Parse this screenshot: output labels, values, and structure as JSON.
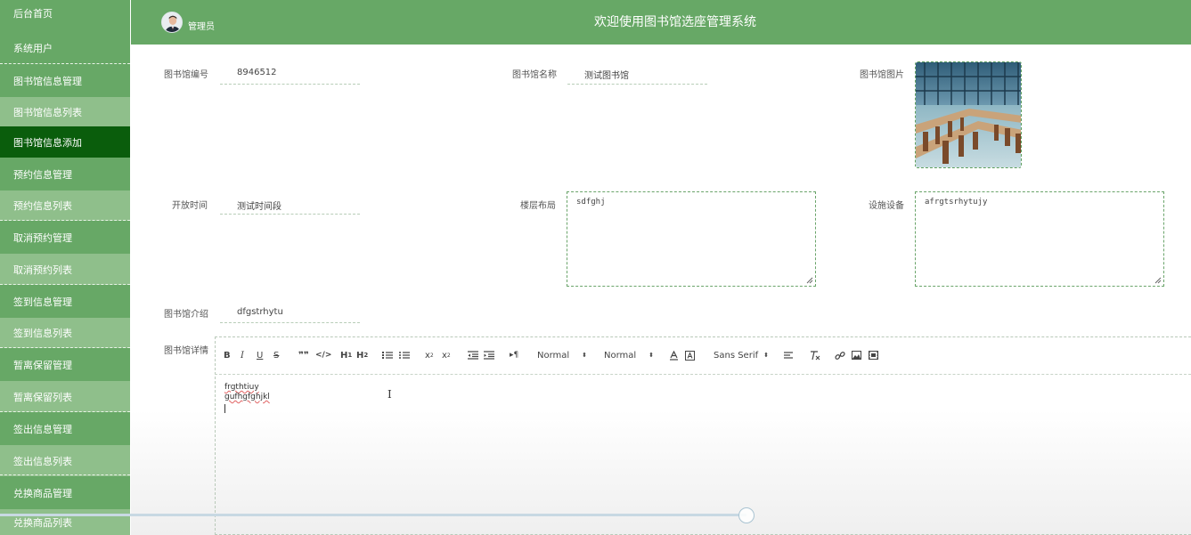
{
  "sidebar": {
    "items": [
      {
        "label": "后台首页",
        "type": "parent",
        "active": false
      },
      {
        "label": "系统用户",
        "type": "parent",
        "active": false
      },
      {
        "label": "图书馆信息管理",
        "type": "parent",
        "active": false
      },
      {
        "label": "图书馆信息列表",
        "type": "child",
        "active": false
      },
      {
        "label": "图书馆信息添加",
        "type": "child",
        "active": true
      },
      {
        "label": "预约信息管理",
        "type": "parent",
        "active": false
      },
      {
        "label": "预约信息列表",
        "type": "child",
        "active": false
      },
      {
        "label": "取消预约管理",
        "type": "parent",
        "active": false
      },
      {
        "label": "取消预约列表",
        "type": "child",
        "active": false
      },
      {
        "label": "签到信息管理",
        "type": "parent",
        "active": false
      },
      {
        "label": "签到信息列表",
        "type": "child",
        "active": false
      },
      {
        "label": "暂离保留管理",
        "type": "parent",
        "active": false
      },
      {
        "label": "暂离保留列表",
        "type": "child",
        "active": false
      },
      {
        "label": "签出信息管理",
        "type": "parent",
        "active": false
      },
      {
        "label": "签出信息列表",
        "type": "child",
        "active": false
      },
      {
        "label": "兑换商品管理",
        "type": "parent",
        "active": false
      },
      {
        "label": "兑换商品列表",
        "type": "child",
        "active": false
      }
    ]
  },
  "header": {
    "admin_label": "管理员",
    "title": "欢迎使用图书馆选座管理系统"
  },
  "form": {
    "library_no": {
      "label": "图书馆编号",
      "value": "8946512"
    },
    "library_name": {
      "label": "图书馆名称",
      "value": "测试图书馆"
    },
    "library_image": {
      "label": "图书馆图片"
    },
    "open_time": {
      "label": "开放时间",
      "value": "测试时间段"
    },
    "floor_layout": {
      "label": "楼层布局",
      "value": "sdfghj"
    },
    "facilities": {
      "label": "设施设备",
      "value": "afrgtsrhytujy"
    },
    "intro": {
      "label": "图书馆介绍",
      "value": "dfgstrhytu"
    },
    "details": {
      "label": "图书馆详情"
    }
  },
  "editor": {
    "toolbar": {
      "header_select": "Normal",
      "size_select": "Normal",
      "font_select": "Sans Serif"
    },
    "lines": [
      "frgthtiuy",
      "gufhgfghjkl"
    ]
  },
  "colors": {
    "sidebar_bg": "#67a866",
    "sidebar_child_bg": "#8fbf8b",
    "sidebar_active_bg": "#0a5d0c",
    "header_bg": "#67a866"
  }
}
